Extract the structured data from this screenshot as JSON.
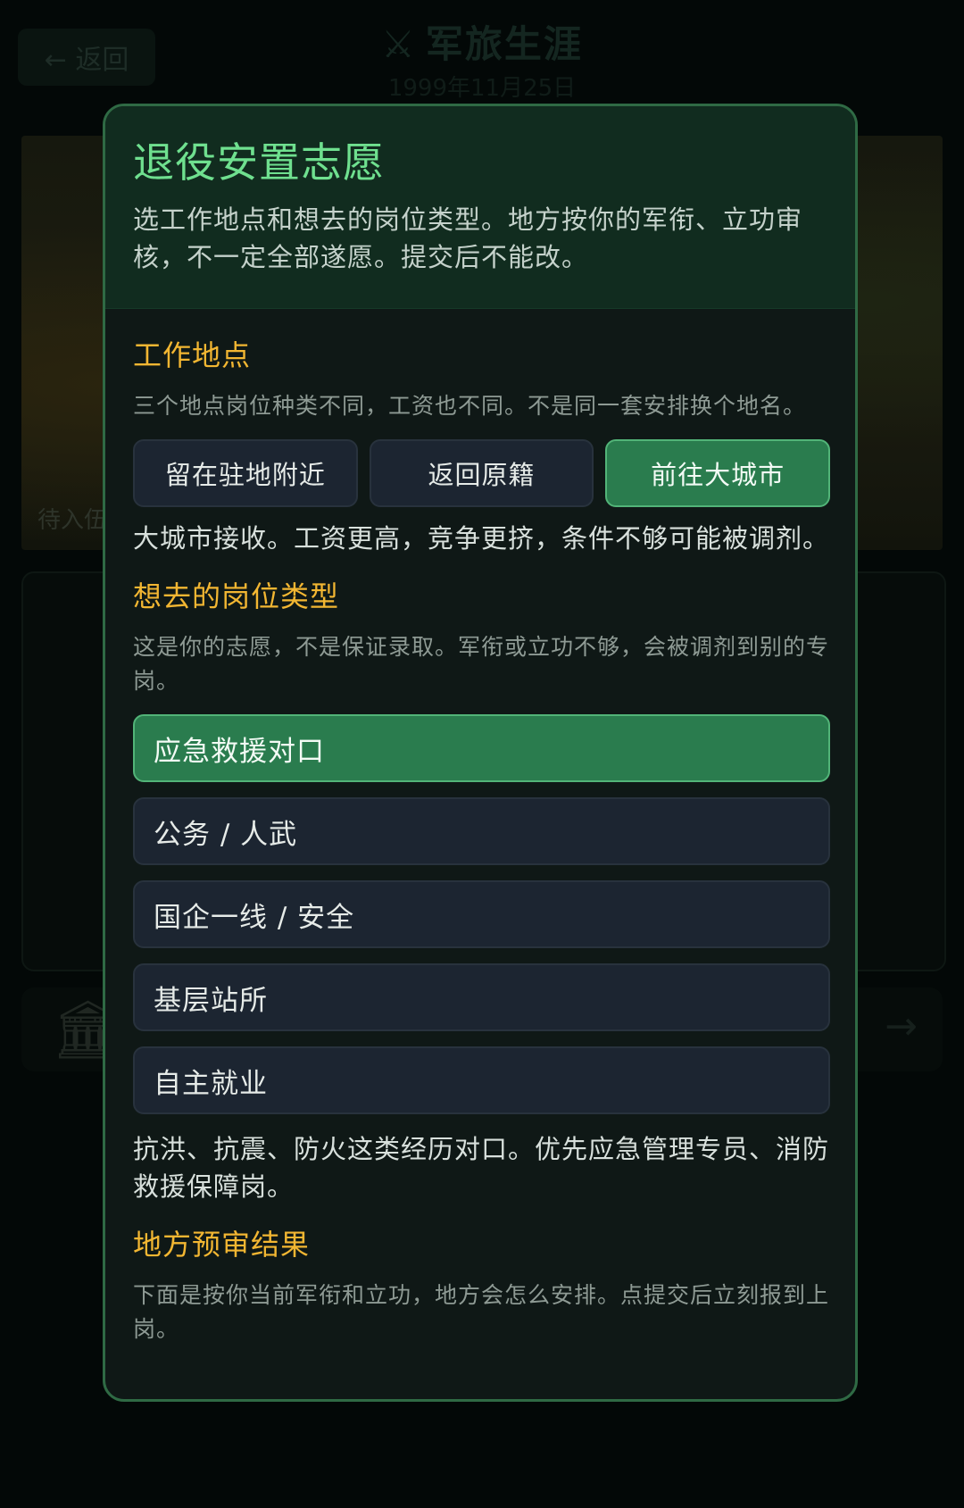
{
  "background": {
    "back_label": "← 返回",
    "title": "军旅生涯",
    "title_icon": "crossed-swords-icon",
    "date": "1999年11月25日",
    "scene_caption": "待入伍",
    "bank_icon": "bank-icon",
    "next_icon": "arrow-right-icon"
  },
  "modal": {
    "title": "退役安置志愿",
    "subtitle": "选工作地点和想去的岗位类型。地方按你的军衔、立功审核，不一定全部遂愿。提交后不能改。",
    "location": {
      "heading": "工作地点",
      "note": "三个地点岗位种类不同，工资也不同。不是同一套安排换个地名。",
      "options": [
        "留在驻地附近",
        "返回原籍",
        "前往大城市"
      ],
      "selected": "前往大城市",
      "selected_desc": "大城市接收。工资更高，竞争更挤，条件不够可能被调剂。"
    },
    "job": {
      "heading": "想去的岗位类型",
      "note": "这是你的志愿，不是保证录取。军衔或立功不够，会被调剂到别的专岗。",
      "options": [
        "应急救援对口",
        "公务 / 人武",
        "国企一线 / 安全",
        "基层站所",
        "自主就业"
      ],
      "selected": "应急救援对口",
      "selected_desc": "抗洪、抗震、防火这类经历对口。优先应急管理专员、消防救援保障岗。"
    },
    "review": {
      "heading": "地方预审结果",
      "note": "下面是按你当前军衔和立功，地方会怎么安排。点提交后立刻报到上岗。"
    }
  },
  "colors": {
    "accent_green": "#2a7c4e",
    "title_green": "#6fe08f",
    "section_gold": "#f2b632",
    "modal_border": "#2f6a44"
  }
}
